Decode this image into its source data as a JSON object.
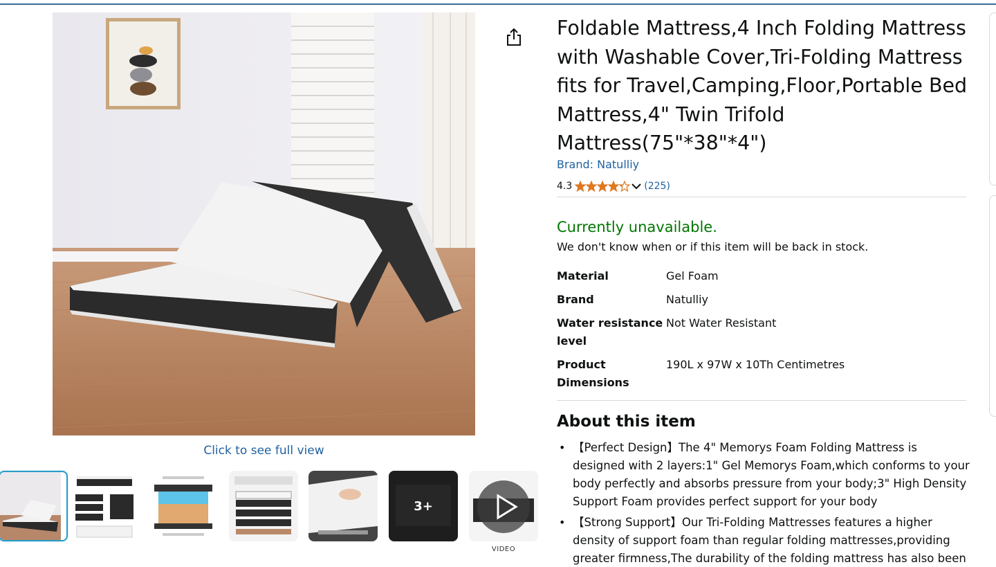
{
  "product": {
    "title": "Foldable Mattress,4 Inch Folding Mattress with Washable Cover,Tri-Folding Mattress fits for Travel,Camping,Floor,Portable Bed Mattress,4\" Twin Trifold Mattress(75\"*38\"*4\")",
    "brand_link": "Brand: Natulliy",
    "rating_value": "4.3",
    "rating_stars": 4.3,
    "review_count": "(225)",
    "star_color": "#de7921"
  },
  "gallery": {
    "full_view_link": "Click to see full view",
    "more_count": "3+",
    "video_caption": "VIDEO",
    "thumbnail_names": [
      "folded-mattress-photo",
      "folded-layers-photo",
      "foam-layer-diagram",
      "size-chart-photo",
      "hand-pressing-foam-photo",
      "dark-mattress-photos",
      "video-thumbnail"
    ]
  },
  "availability": {
    "status": "Currently unavailable.",
    "note": "We don't know when or if this item will be back in stock.",
    "status_color": "#007600"
  },
  "specs": [
    {
      "key": "Material",
      "value": "Gel Foam"
    },
    {
      "key": "Brand",
      "value": "Natulliy"
    },
    {
      "key": "Water resistance level",
      "value": "Not Water Resistant"
    },
    {
      "key": "Product Dimensions",
      "value": "190L x 97W x 10Th Centimetres"
    }
  ],
  "about": {
    "heading": "About this item",
    "bullets": [
      "【Perfect Design】The 4\" Memorys Foam Folding Mattress is designed with 2 layers:1\" Gel Memorys Foam,which conforms to your body perfectly and absorbs pressure from your body;3\" High Density Support Foam provides perfect support for your body",
      "【Strong Support】Our Tri-Folding Mattresses features a higher density of support foam than regular folding mattresses,providing greater firmness,The durability of the folding mattress has also been"
    ]
  },
  "colors": {
    "link": "#2162a1",
    "accent_border": "#2a9dc8"
  },
  "icons": [
    "share-icon",
    "chevron-down-icon",
    "star-icon",
    "play-icon"
  ]
}
